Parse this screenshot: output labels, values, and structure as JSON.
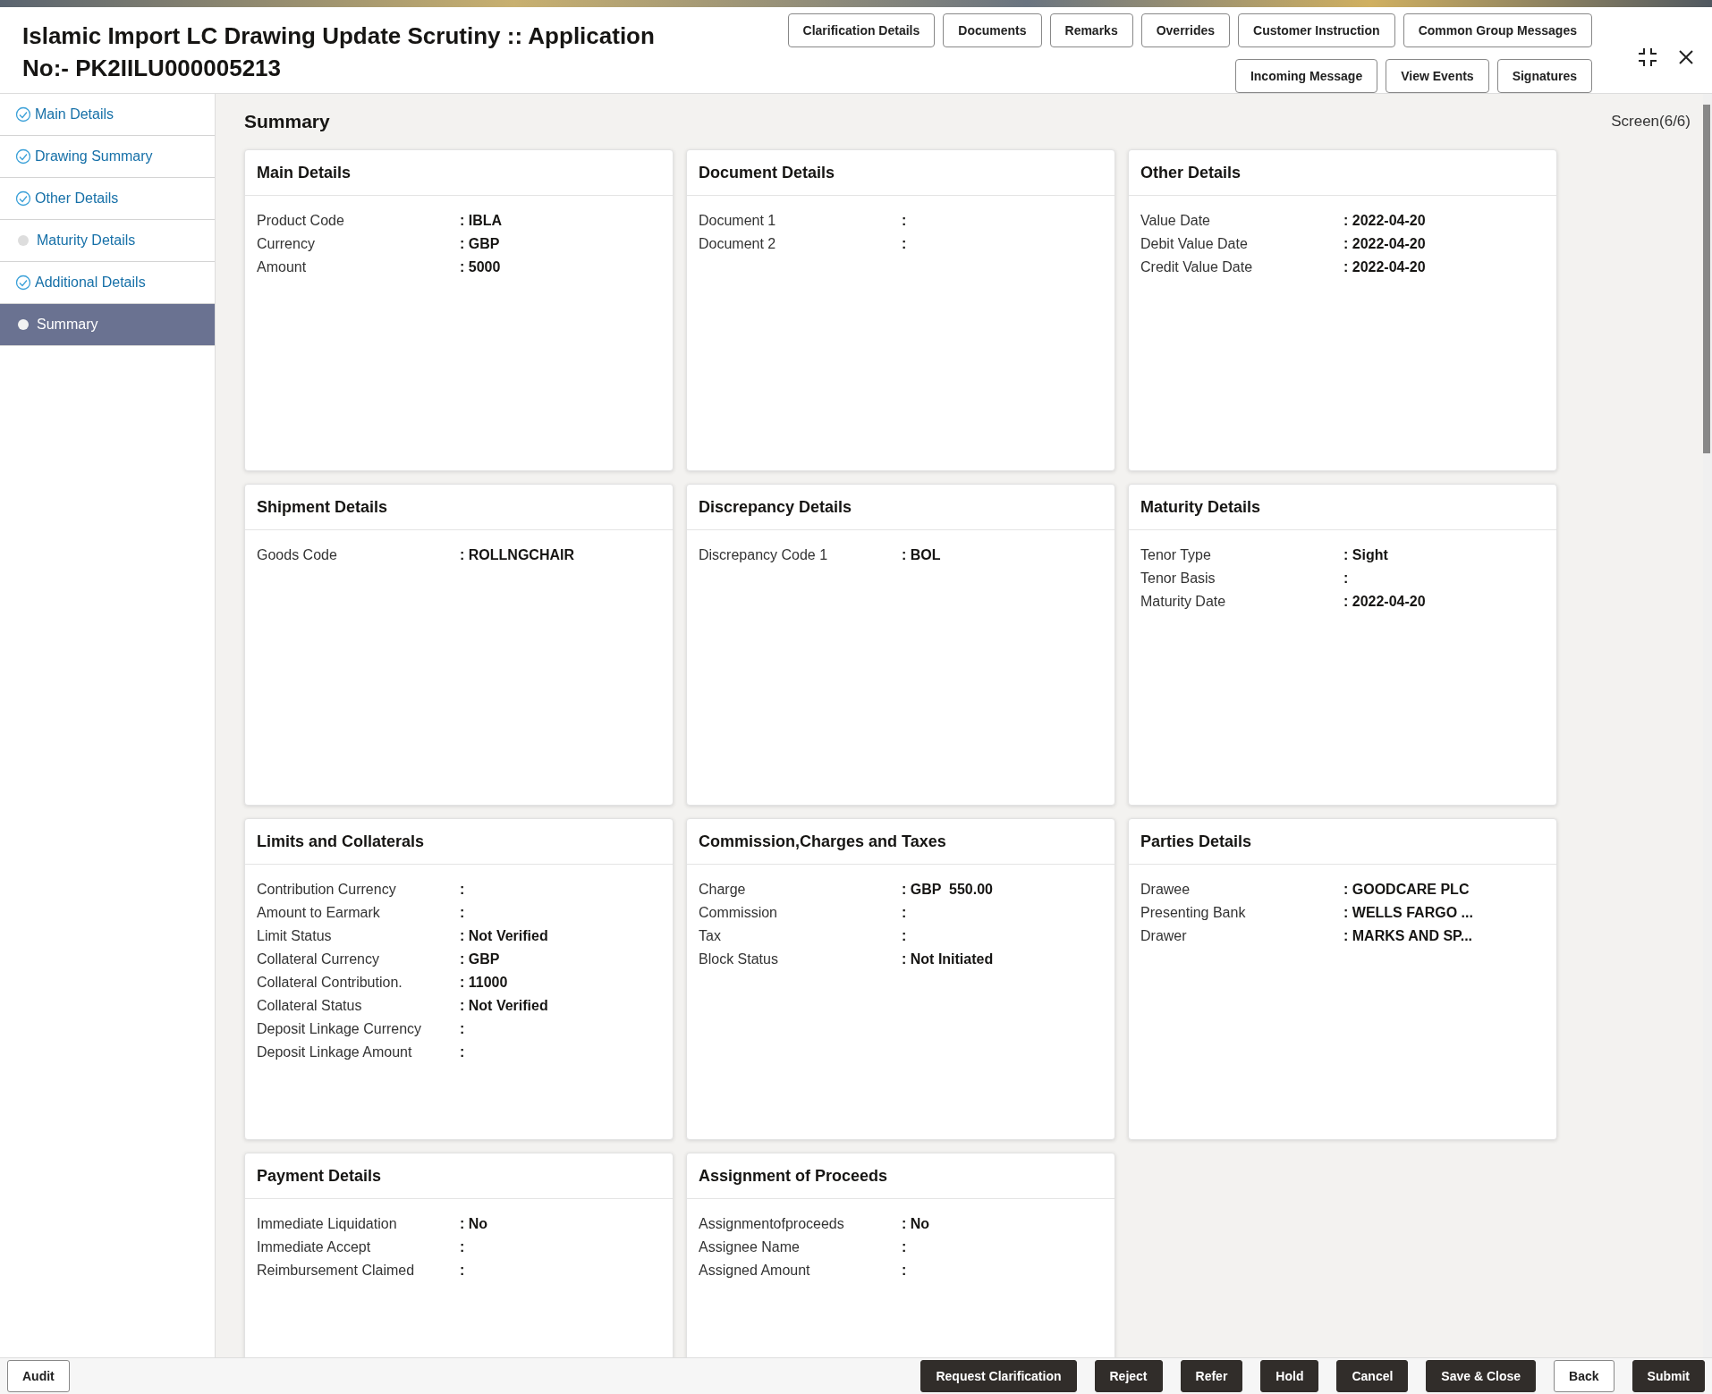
{
  "window": {
    "title": "Islamic Import LC Drawing Update Scrutiny :: Application No:- PK2IILU000005213"
  },
  "header_buttons": [
    [
      "Clarification Details",
      "Documents",
      "Remarks",
      "Overrides",
      "Customer Instruction",
      "Common Group Messages"
    ],
    [
      "Incoming Message",
      "View Events",
      "Signatures"
    ]
  ],
  "sidebar": {
    "items": [
      {
        "label": "Main Details",
        "completed": true,
        "selected": false
      },
      {
        "label": "Drawing Summary",
        "completed": true,
        "selected": false
      },
      {
        "label": "Other Details",
        "completed": true,
        "selected": false
      },
      {
        "label": "Maturity Details",
        "completed": false,
        "selected": false
      },
      {
        "label": "Additional Details",
        "completed": true,
        "selected": false
      },
      {
        "label": "Summary",
        "completed": false,
        "selected": true
      }
    ]
  },
  "page": {
    "title": "Summary",
    "screen": "Screen(6/6)"
  },
  "cards": [
    {
      "title": "Main Details",
      "fields": [
        {
          "label": "Product Code",
          "value": ": IBLA"
        },
        {
          "label": "Currency",
          "value": ": GBP"
        },
        {
          "label": "Amount",
          "value": ": 5000"
        }
      ]
    },
    {
      "title": "Document Details",
      "fields": [
        {
          "label": "Document 1",
          "value": ":"
        },
        {
          "label": "Document 2",
          "value": ":"
        }
      ]
    },
    {
      "title": "Other Details",
      "fields": [
        {
          "label": "Value Date",
          "value": ": 2022-04-20"
        },
        {
          "label": "Debit Value Date",
          "value": ": 2022-04-20"
        },
        {
          "label": "Credit Value Date",
          "value": ": 2022-04-20"
        }
      ]
    },
    {
      "title": "Shipment Details",
      "fields": [
        {
          "label": "Goods Code",
          "value": ": ROLLNGCHAIR"
        }
      ]
    },
    {
      "title": "Discrepancy Details",
      "fields": [
        {
          "label": "Discrepancy Code 1",
          "value": ": BOL"
        }
      ]
    },
    {
      "title": "Maturity Details",
      "fields": [
        {
          "label": "Tenor Type",
          "value": ": Sight"
        },
        {
          "label": "Tenor Basis",
          "value": ":"
        },
        {
          "label": "Maturity Date",
          "value": ": 2022-04-20"
        }
      ]
    },
    {
      "title": "Limits and Collaterals",
      "fields": [
        {
          "label": "Contribution Currency",
          "value": ":"
        },
        {
          "label": "Amount to Earmark",
          "value": ":"
        },
        {
          "label": "Limit Status",
          "value": ": Not Verified"
        },
        {
          "label": "Collateral Currency",
          "value": ": GBP"
        },
        {
          "label": "Collateral Contribution.",
          "value": ": 11000"
        },
        {
          "label": "Collateral Status",
          "value": ": Not Verified"
        },
        {
          "label": "Deposit Linkage Currency",
          "value": ":"
        },
        {
          "label": "Deposit Linkage Amount",
          "value": ":"
        }
      ]
    },
    {
      "title": "Commission,Charges and Taxes",
      "fields": [
        {
          "label": "Charge",
          "value": ": GBP  550.00"
        },
        {
          "label": "Commission",
          "value": ":"
        },
        {
          "label": "Tax",
          "value": ":"
        },
        {
          "label": "Block Status",
          "value": ": Not Initiated"
        }
      ]
    },
    {
      "title": "Parties Details",
      "fields": [
        {
          "label": "Drawee",
          "value": ": GOODCARE PLC"
        },
        {
          "label": "Presenting Bank",
          "value": ": WELLS FARGO ..."
        },
        {
          "label": "Drawer",
          "value": ": MARKS AND SP..."
        }
      ]
    },
    {
      "title": "Payment Details",
      "fields": [
        {
          "label": "Immediate Liquidation",
          "value": ": No"
        },
        {
          "label": "Immediate Accept",
          "value": ":"
        },
        {
          "label": "Reimbursement Claimed",
          "value": ":"
        }
      ]
    },
    {
      "title": "Assignment of Proceeds",
      "fields": [
        {
          "label": "Assignmentofproceeds",
          "value": ": No"
        },
        {
          "label": "Assignee Name",
          "value": ":"
        },
        {
          "label": "Assigned Amount",
          "value": ":"
        }
      ]
    }
  ],
  "footer": {
    "left": [
      {
        "label": "Audit",
        "kind": "secondary"
      }
    ],
    "right": [
      {
        "label": "Request Clarification",
        "kind": "primary"
      },
      {
        "label": "Reject",
        "kind": "primary"
      },
      {
        "label": "Refer",
        "kind": "primary"
      },
      {
        "label": "Hold",
        "kind": "primary"
      },
      {
        "label": "Cancel",
        "kind": "primary"
      },
      {
        "label": "Save & Close",
        "kind": "primary"
      },
      {
        "label": "Back",
        "kind": "secondary"
      },
      {
        "label": "Submit",
        "kind": "primary"
      }
    ]
  }
}
